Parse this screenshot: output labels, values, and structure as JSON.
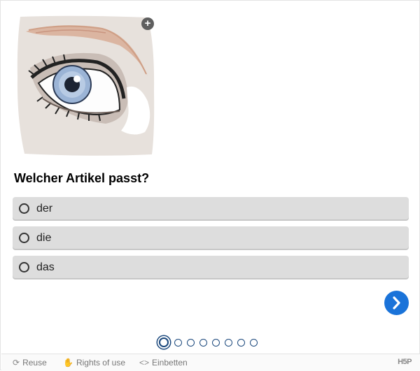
{
  "image": {
    "icon": "eye-illustration",
    "zoom_label": "+"
  },
  "question": {
    "text": "Welcher Artikel passt?"
  },
  "answers": [
    {
      "label": "der",
      "selected": false
    },
    {
      "label": "die",
      "selected": false
    },
    {
      "label": "das",
      "selected": false
    }
  ],
  "navigation": {
    "next_icon": "chevron-right-icon",
    "total_questions": 8,
    "current_index": 0
  },
  "footer": {
    "reuse_label": "Reuse",
    "rights_label": "Rights of use",
    "embed_label": "Einbetten",
    "logo_text": "H5P"
  },
  "colors": {
    "accent": "#1a73d9",
    "progress": "#1d4a7e",
    "answer_bg": "#dddddd"
  }
}
